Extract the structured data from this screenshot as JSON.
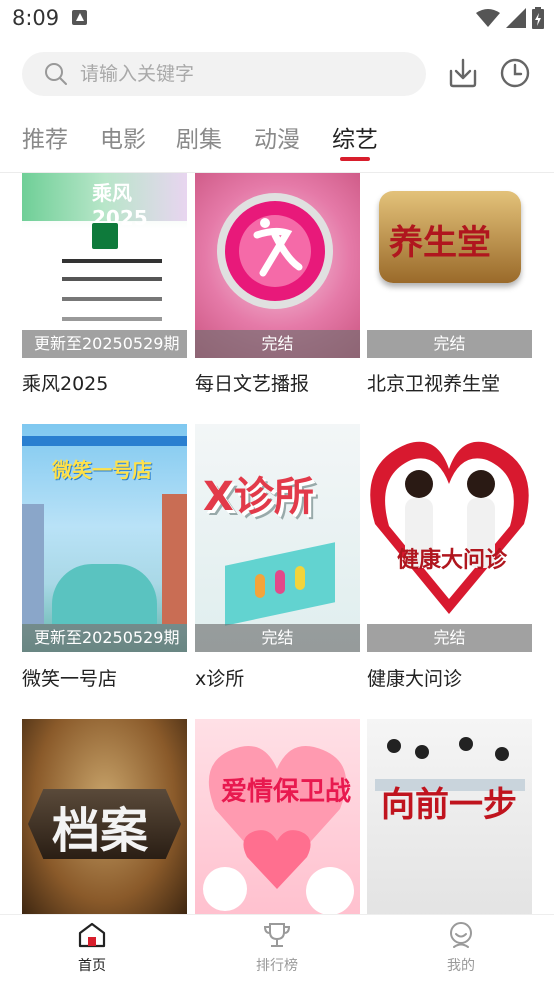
{
  "status": {
    "time": "8:09"
  },
  "search": {
    "placeholder": "请输入关键字"
  },
  "tabs": [
    {
      "label": "推荐"
    },
    {
      "label": "电影"
    },
    {
      "label": "剧集"
    },
    {
      "label": "动漫"
    },
    {
      "label": "综艺"
    }
  ],
  "cards": [
    {
      "title": "乘风2025",
      "badge": "更新至20250529期",
      "poster_text": "乘风2025"
    },
    {
      "title": "每日文艺播报",
      "badge": "完结"
    },
    {
      "title": "北京卫视养生堂",
      "badge": "完结",
      "poster_text": "养生堂"
    },
    {
      "title": "微笑一号店",
      "badge": "更新至20250529期",
      "poster_text": "微笑一号店"
    },
    {
      "title": "x诊所",
      "badge": "完结",
      "poster_text": "X诊所"
    },
    {
      "title": "健康大问诊",
      "badge": "完结",
      "poster_text": "健康大问诊"
    },
    {
      "title": "",
      "badge": "",
      "poster_text": "档案"
    },
    {
      "title": "",
      "badge": "",
      "poster_text": "爱情保卫战"
    },
    {
      "title": "",
      "badge": "",
      "poster_text": "向前一步"
    }
  ],
  "bottom_nav": [
    {
      "label": "首页",
      "icon": "home-icon"
    },
    {
      "label": "排行榜",
      "icon": "trophy-icon"
    },
    {
      "label": "我的",
      "icon": "profile-icon"
    }
  ],
  "colors": {
    "accent": "#d81e2c"
  }
}
